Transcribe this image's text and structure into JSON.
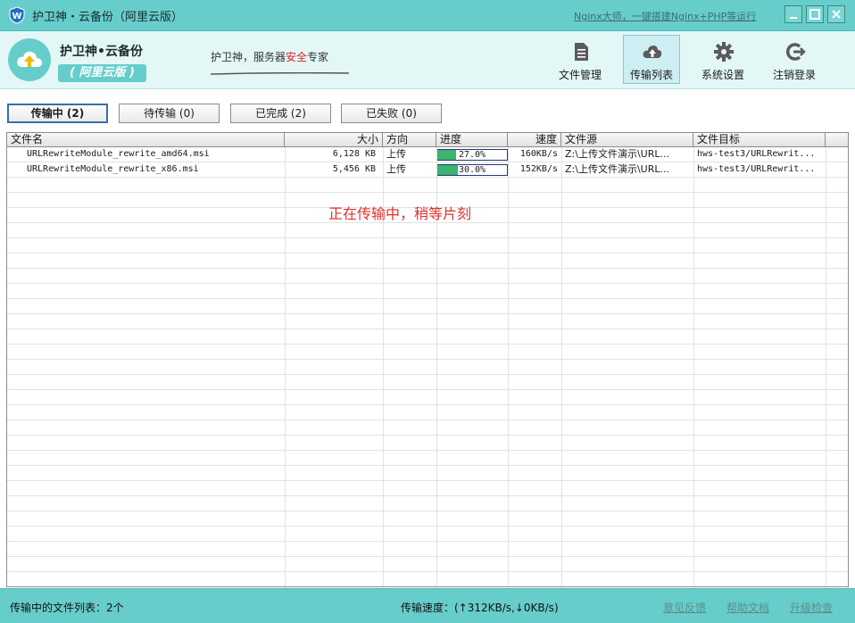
{
  "window": {
    "title": "护卫神・云备份（阿里云版）",
    "promo_link": "Nginx大师，一键搭建Nginx+PHP等运行"
  },
  "header": {
    "brand_name": "护卫神•云备份",
    "brand_edition": "( 阿里云版 )",
    "slogan_prefix": "护卫神，服务器",
    "slogan_accent": "安全",
    "slogan_suffix": "专家"
  },
  "nav": {
    "file_manage": "文件管理",
    "transfer_list": "传输列表",
    "settings": "系统设置",
    "logout": "注销登录"
  },
  "tabs": {
    "transferring": "传输中 (2)",
    "waiting": "待传输 (0)",
    "completed": "已完成 (2)",
    "failed": "已失败 (0)"
  },
  "table": {
    "columns": {
      "name": "文件名",
      "size": "大小",
      "direction": "方向",
      "progress": "进度",
      "speed": "速度",
      "source": "文件源",
      "target": "文件目标"
    },
    "rows": [
      {
        "name": "URLRewriteModule_rewrite_amd64.msi",
        "size": "6,128 KB",
        "direction": "上传",
        "progress_label": "27.0%",
        "progress": 0.27,
        "speed": "160KB/s",
        "source": "Z:\\上传文件演示\\URL...",
        "target": "hws-test3/URLRewrit..."
      },
      {
        "name": "URLRewriteModule_rewrite_x86.msi",
        "size": "5,456 KB",
        "direction": "上传",
        "progress_label": "30.0%",
        "progress": 0.3,
        "speed": "152KB/s",
        "source": "Z:\\上传文件演示\\URL...",
        "target": "hws-test3/URLRewrit..."
      }
    ]
  },
  "message": "正在传输中，稍等片刻",
  "status": {
    "file_count": "传输中的文件列表：2个",
    "speed": "传输速度：(↑312KB/s,↓0KB/s)",
    "feedback": "意见反馈",
    "help": "帮助文档",
    "upgrade": "升级检查"
  },
  "colors": {
    "accent": "#66cdca",
    "header_bg": "#e4f7f7",
    "progress_fill": "#3cb371",
    "message": "#e03030"
  }
}
